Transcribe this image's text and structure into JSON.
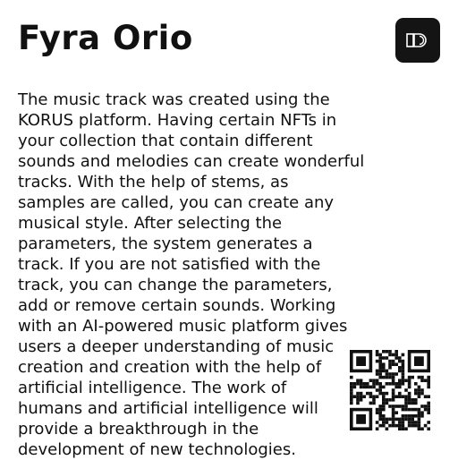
{
  "header": {
    "title": "Fyra Orio",
    "logo_icon": "korus-logo-icon",
    "logo_bg": "#141414"
  },
  "description": {
    "lines": [
      "The music track was created using the",
      "KORUS platform. Having certain NFTs in",
      "your collection that contain different",
      "sounds and melodies can create wonderful",
      "tracks. With the help of stems, as",
      "samples are called, you can create any",
      "musical style. After selecting the",
      "parameters, the system generates a",
      "track. If you are not satisfied with the",
      "track, you can change the parameters,",
      "add or remove certain sounds. Working",
      "with an AI-powered music platform gives",
      "users a deeper understanding of music",
      "creation and creation with the help of",
      "artificial intelligence. The work of",
      "humans and artificial intelligence will",
      "provide a breakthrough in the",
      "development of new technologies."
    ]
  },
  "qr_code": {
    "icon": "qr-code-icon"
  }
}
